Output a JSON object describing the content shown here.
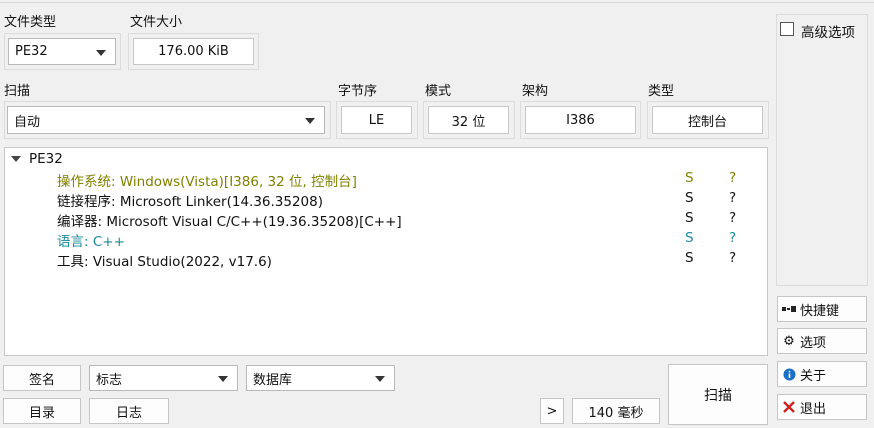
{
  "file_type": {
    "label": "文件类型",
    "value": "PE32"
  },
  "file_size": {
    "label": "文件大小",
    "value": "176.00 KiB"
  },
  "scan": {
    "label": "扫描",
    "value": "自动"
  },
  "endianness": {
    "label": "字节序",
    "value": "LE"
  },
  "mode": {
    "label": "模式",
    "value": "32 位"
  },
  "arch": {
    "label": "架构",
    "value": "I386"
  },
  "type": {
    "label": "类型",
    "value": "控制台"
  },
  "advanced_option": {
    "label": "高级选项",
    "checked": false
  },
  "tree": {
    "root": "PE32",
    "rows": [
      {
        "text": "操作系统: Windows(Vista)[I386, 32 位, 控制台]",
        "s": "S",
        "q": "?",
        "color": "#808000"
      },
      {
        "text": "链接程序: Microsoft Linker(14.36.35208)",
        "s": "S",
        "q": "?",
        "color": "#111111"
      },
      {
        "text": "编译器: Microsoft Visual C/C++(19.36.35208)[C++]",
        "s": "S",
        "q": "?",
        "color": "#111111"
      },
      {
        "text": "语言: C++",
        "s": "S",
        "q": "?",
        "color": "#1b8a9a"
      },
      {
        "text": "工具: Visual Studio(2022, v17.6)",
        "s": "S",
        "q": "?",
        "color": "#111111"
      }
    ]
  },
  "bottom": {
    "signature": "签名",
    "flags": "标志",
    "database": "数据库",
    "directory": "目录",
    "log": "日志",
    "more": ">",
    "time": "140 毫秒",
    "scan_button": "扫描"
  },
  "side": {
    "shortcut": "快捷键",
    "options": "选项",
    "about": "关于",
    "exit": "退出"
  },
  "colors": {
    "os_row": "#808000",
    "language_row": "#1b8a9a",
    "exit_icon": "#cc2222",
    "about_icon": "#1a6fc8"
  }
}
